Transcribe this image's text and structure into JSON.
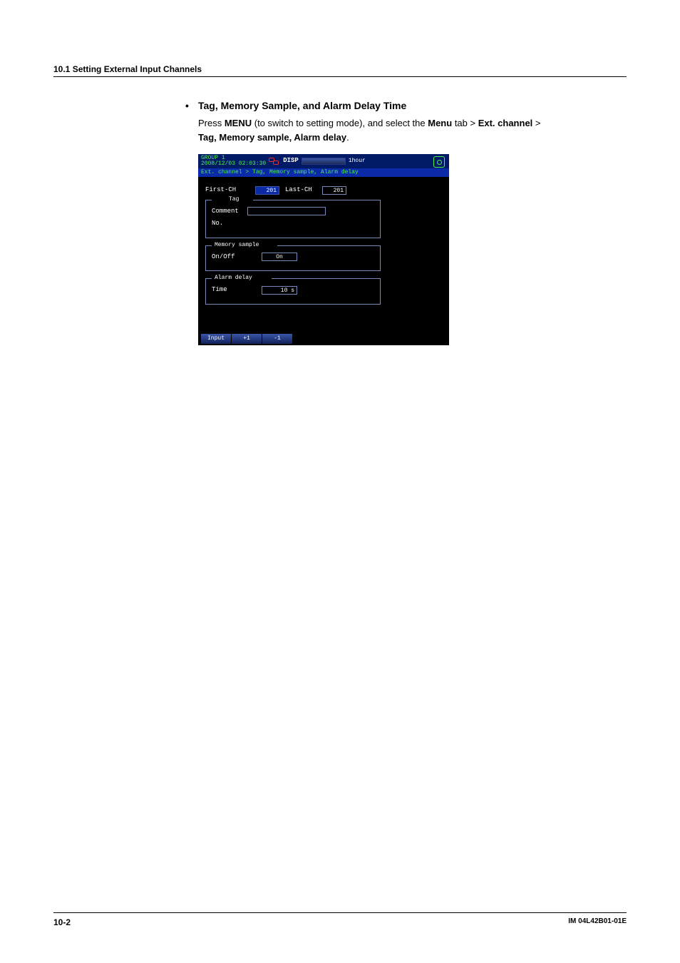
{
  "header": "10.1  Setting External Input Channels",
  "bullet": "Tag, Memory Sample, and Alarm Delay Time",
  "para_pre": "Press ",
  "para_menu": "MENU",
  "para_mid1": " (to switch to setting mode), and select the ",
  "para_menu2": "Menu",
  "para_mid2": " tab > ",
  "para_ext": "Ext. channel",
  "para_mid3": " > ",
  "para_line2": "Tag, Memory sample, Alarm delay",
  "para_end": ".",
  "ss": {
    "group_line1": "GROUP 1",
    "group_line2": "2008/12/03 02:03:30",
    "disp": "DISP",
    "hour": "1hour",
    "breadcrumb": "Ext. channel > Tag, Memory sample, Alarm delay",
    "first_ch_lbl": "First-CH",
    "first_ch_val": "201",
    "last_ch_lbl": "Last-CH",
    "last_ch_val": "201",
    "tag_title": "Tag",
    "comment_lbl": "Comment",
    "no_lbl": "No.",
    "mem_title": "Memory sample",
    "onoff_lbl": "On/Off",
    "onoff_val": "On",
    "delay_title": "Alarm delay",
    "time_lbl": "Time",
    "time_val": "10 s",
    "soft": [
      "Input",
      "+1",
      "-1"
    ]
  },
  "footer": {
    "page": "10-2",
    "doc": "IM 04L42B01-01E"
  }
}
